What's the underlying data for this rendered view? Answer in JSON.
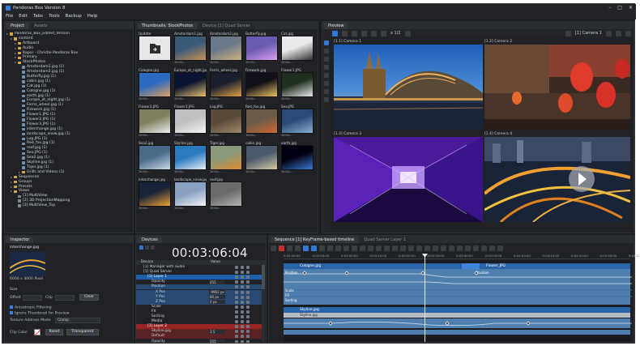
{
  "window": {
    "title": "Pandoras Box  Version 8",
    "controls": [
      "–",
      "□",
      "✕"
    ]
  },
  "menu": [
    "File",
    "Edit",
    "Tabs",
    "Tools",
    "Backup",
    "Help"
  ],
  "project": {
    "tabs": [
      "Project",
      "Assets"
    ],
    "tree": [
      {
        "d": 0,
        "t": "folder",
        "label": "Pandoras_Box_Edited_Version"
      },
      {
        "d": 1,
        "t": "folder",
        "label": "content"
      },
      {
        "d": 2,
        "t": "folder",
        "label": "Artboard"
      },
      {
        "d": 2,
        "t": "folder",
        "label": "Audio"
      },
      {
        "d": 2,
        "t": "folder",
        "label": "Kapor - Christie Pandoras Box"
      },
      {
        "d": 2,
        "t": "folder",
        "label": "Primary"
      },
      {
        "d": 2,
        "t": "folder",
        "label": "StockPhotos"
      },
      {
        "d": 3,
        "t": "file",
        "label": "Amsterdam1.jpg (1)"
      },
      {
        "d": 3,
        "t": "file",
        "label": "Amsterdam2.jpg (1)"
      },
      {
        "d": 3,
        "t": "file",
        "label": "Butterfly.jpg (1)"
      },
      {
        "d": 3,
        "t": "file",
        "label": "cabin.jpg (1)"
      },
      {
        "d": 3,
        "t": "file",
        "label": "Cat.jpg (1)"
      },
      {
        "d": 3,
        "t": "file",
        "label": "Cologne.jpg (1)"
      },
      {
        "d": 3,
        "t": "file",
        "label": "earth.jpg (1)"
      },
      {
        "d": 3,
        "t": "file",
        "label": "Europe_at_night.jpg (1)"
      },
      {
        "d": 3,
        "t": "file",
        "label": "Ferris_wheel.jpg (1)"
      },
      {
        "d": 3,
        "t": "file",
        "label": "Firework.jpg (1)"
      },
      {
        "d": 3,
        "t": "file",
        "label": "Flower1.JPG (1)"
      },
      {
        "d": 3,
        "t": "file",
        "label": "Flower2.JPG (1)"
      },
      {
        "d": 3,
        "t": "file",
        "label": "Flower3.JPG (1)"
      },
      {
        "d": 3,
        "t": "file",
        "label": "interchange.jpg (1)"
      },
      {
        "d": 3,
        "t": "file",
        "label": "landscape_snow.jpg (1)"
      },
      {
        "d": 3,
        "t": "file",
        "label": "Log.JPG (1)"
      },
      {
        "d": 3,
        "t": "file",
        "label": "Red_fox.jpg (1)"
      },
      {
        "d": 3,
        "t": "file",
        "label": "roof.jpg (1)"
      },
      {
        "d": 3,
        "t": "file",
        "label": "Sea.JPG (1)"
      },
      {
        "d": 3,
        "t": "file",
        "label": "Sea2.jpg (1)"
      },
      {
        "d": 3,
        "t": "file",
        "label": "Skyline.jpg (1)"
      },
      {
        "d": 3,
        "t": "file",
        "label": "Tiger.jpg (1)"
      },
      {
        "d": 3,
        "t": "folder",
        "label": "Grills and Videos (1)"
      },
      {
        "d": 1,
        "t": "folder",
        "label": "Sequences"
      },
      {
        "d": 1,
        "t": "folder",
        "label": "Groups"
      },
      {
        "d": 1,
        "t": "folder",
        "label": "Presets"
      },
      {
        "d": 1,
        "t": "folder",
        "label": "Views"
      },
      {
        "d": 2,
        "t": "view",
        "label": "[1] MultiView"
      },
      {
        "d": 2,
        "t": "view",
        "label": "[2] 3D ProjectionMapping"
      },
      {
        "d": 2,
        "t": "view",
        "label": "[3] MultiView_Top"
      }
    ]
  },
  "thumbnails": {
    "tabs": [
      "Thumbnails: StockPhotos",
      "Device [1] Quad Server"
    ],
    "items": [
      {
        "name": "Update",
        "res": "",
        "img": "upload-icon"
      },
      {
        "name": "Amsterdam1.jpg",
        "res": "3840x...",
        "img": "amsterdam1"
      },
      {
        "name": "Amsterdam2.jpg",
        "res": "3840x...",
        "img": "amsterdam2"
      },
      {
        "name": "Butterfly.jpg",
        "res": "3840x...",
        "img": "butterfly"
      },
      {
        "name": "Cat.jpg",
        "res": "3840x...",
        "img": "cat"
      },
      {
        "name": "Cologne.jpg",
        "res": "3840x...",
        "img": "cologne"
      },
      {
        "name": "Europe_at_night.jpg",
        "res": "3840x...",
        "img": "europe"
      },
      {
        "name": "Ferris_wheel.jpg",
        "res": "3840x...",
        "img": "ferris"
      },
      {
        "name": "Firework.jpg",
        "res": "3840x...",
        "img": "firework"
      },
      {
        "name": "Flower1.JPG",
        "res": "3840x...",
        "img": "flower1"
      },
      {
        "name": "Flower2.JPG",
        "res": "3840x...",
        "img": "flower2"
      },
      {
        "name": "Flower3.JPG",
        "res": "3840x...",
        "img": "flower3"
      },
      {
        "name": "Log.JPG",
        "res": "3840x...",
        "img": "log"
      },
      {
        "name": "Red_fox.jpg",
        "res": "3840x...",
        "img": "fox"
      },
      {
        "name": "Sea.JPG",
        "res": "3840x...",
        "img": "sea"
      },
      {
        "name": "Sea2.jpg",
        "res": "3840x...",
        "img": "sea2"
      },
      {
        "name": "Skyline.jpg",
        "res": "3840x...",
        "img": "skyline"
      },
      {
        "name": "Tiger.jpg",
        "res": "3840x...",
        "img": "tiger"
      },
      {
        "name": "cabin.jpg",
        "res": "3840x...",
        "img": "cabin"
      },
      {
        "name": "earth.jpg",
        "res": "3840x...",
        "img": "earth"
      },
      {
        "name": "interchange.jpg",
        "res": "3840x...",
        "img": "interchange"
      },
      {
        "name": "landscape_snow.jpg",
        "res": "3840x...",
        "img": "snow"
      },
      {
        "name": "roof.jpg",
        "res": "3840x...",
        "img": "roof"
      }
    ]
  },
  "preview": {
    "tabs": [
      "Preview"
    ],
    "zoom": "x 1/2",
    "camera_select": "[1] Camera 1",
    "cameras": [
      "[1.1] Camera 1",
      "[1.2] Camera 2",
      "[1.3] Camera 3",
      "[1.4] Camera 4"
    ]
  },
  "inspector": {
    "tabs": [
      "Inspector"
    ],
    "file_name": "interchange.jpg",
    "resolution": "6000 x 4000 Pixel",
    "labels": {
      "size": "Size",
      "offset": "Offset",
      "clip": "Clip",
      "aniso": "Anisotropic Filtering",
      "ignore": "Ignore Thumbnail for Preview",
      "texture": "Texture Address Mode",
      "clip_color": "Clip Color"
    },
    "clear_button": "Clear",
    "texture_mode": "Clamp",
    "reset_button": "Reset",
    "transparent_button": "Transparent"
  },
  "devices": {
    "tabs": [
      "Devices"
    ],
    "timecode": "00:03:06:04",
    "col_device": "Device",
    "col_value": "Value",
    "rows": [
      {
        "label": "[1] Manager with audio",
        "value": "",
        "d": 1,
        "hl": ""
      },
      {
        "label": "[1] Quad Server",
        "value": "",
        "d": 1,
        "hl": ""
      },
      {
        "label": "[1] Layer 1",
        "value": "",
        "d": 2,
        "hl": "blue"
      },
      {
        "label": "Opacity",
        "value": "255",
        "d": 3,
        "hl": ""
      },
      {
        "label": "Position",
        "value": "",
        "d": 3,
        "hl": "sub"
      },
      {
        "label": "X Pos",
        "value": "-9962 px",
        "d": 4,
        "hl": "sub"
      },
      {
        "label": "Y Pos",
        "value": "80 px",
        "d": 4,
        "hl": "sub"
      },
      {
        "label": "Z Pos",
        "value": "0 px",
        "d": 4,
        "hl": "sub"
      },
      {
        "label": "Scale",
        "value": "",
        "d": 3,
        "hl": ""
      },
      {
        "label": "FX",
        "value": "",
        "d": 3,
        "hl": ""
      },
      {
        "label": "Sorting",
        "value": "",
        "d": 3,
        "hl": ""
      },
      {
        "label": "Media",
        "value": "",
        "d": 3,
        "hl": ""
      },
      {
        "label": "[1] Layer 2",
        "value": "",
        "d": 2,
        "hl": "red"
      },
      {
        "label": "Skyline.jpg",
        "value": "3.5",
        "d": 3,
        "hl": "redsub"
      },
      {
        "label": "Default",
        "value": "",
        "d": 3,
        "hl": "redsub"
      },
      {
        "label": "Opacity",
        "value": "255",
        "d": 3,
        "hl": ""
      },
      {
        "label": "Position",
        "value": "",
        "d": 3,
        "hl": ""
      }
    ]
  },
  "sequence": {
    "tabs": [
      "Sequence [1] KeyFrame-based timeline",
      "Quad Server Layer 1"
    ],
    "ruler": [
      "0:02:40:00",
      "0:02:50:00",
      "0:03:00:00",
      "0:03:10:00",
      "0:03:20:00",
      "0:03:30:00",
      "0:03:40:00",
      "0:03:50:00",
      "0:04:00:00",
      "0:04:10:00",
      "0:04:20:00",
      "0:04:30:00",
      "0:04:40:00"
    ],
    "clip1_a": "Cologne.jpg",
    "clip1_b": "Flower_JPG",
    "clip2_a": "Skyline.jpg",
    "lane_labels": [
      "Position",
      "Position",
      "Scale",
      "FX",
      "Sorting"
    ],
    "clip2_lane": "Skyline.jpg"
  },
  "colors": {
    "accent": "#2f78d6",
    "layer1": "#1d5fa8",
    "layer2": "#9a2424",
    "panel": "#202226",
    "track": "#4e7fae"
  }
}
